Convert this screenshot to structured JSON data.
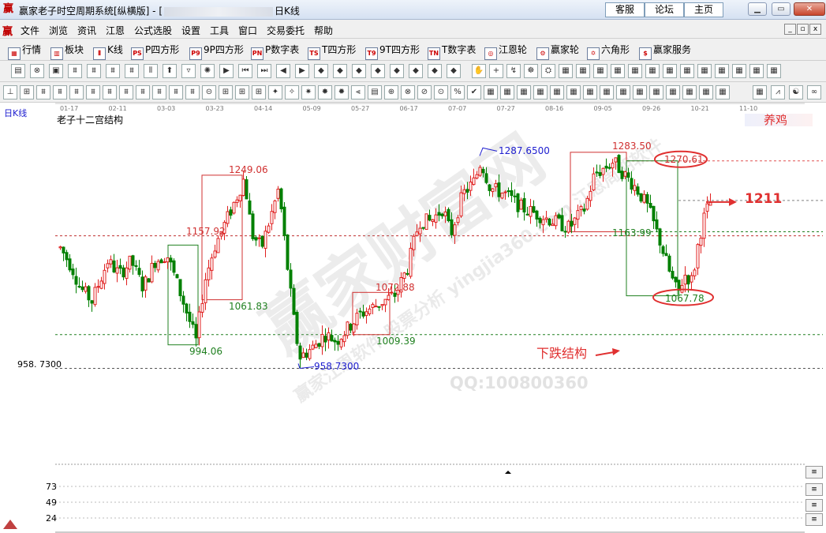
{
  "window": {
    "app_icon": "赢",
    "title_prefix": "赢家老子时空周期系统[纵横版] - [",
    "title_suffix": "日K线",
    "links": [
      "客服",
      "论坛",
      "主页"
    ],
    "controls": [
      "▁",
      "▭",
      "✕"
    ]
  },
  "menu": {
    "icon": "赢",
    "items": [
      "文件",
      "浏览",
      "资讯",
      "江恩",
      "公式选股",
      "设置",
      "工具",
      "窗口",
      "交易委托",
      "帮助"
    ],
    "mdi": [
      "_",
      "▫",
      "x"
    ]
  },
  "toolbar1": {
    "items": [
      {
        "label": "行情",
        "icon": "▦"
      },
      {
        "label": "板块",
        "icon": "▥"
      },
      {
        "label": "K线",
        "icon": "⫴"
      },
      {
        "label": "P四方形",
        "icon": "PS"
      },
      {
        "label": "9P四方形",
        "icon": "P9"
      },
      {
        "label": "P数字表",
        "icon": "PN"
      },
      {
        "label": "T四方形",
        "icon": "TS"
      },
      {
        "label": "9T四方形",
        "icon": "T9"
      },
      {
        "label": "T数字表",
        "icon": "TN"
      },
      {
        "label": "江恩轮",
        "icon": "◎"
      },
      {
        "label": "赢家轮",
        "icon": "⚙"
      },
      {
        "label": "六角形",
        "icon": "✡"
      },
      {
        "label": "赢家服务",
        "icon": "$"
      }
    ]
  },
  "chart": {
    "period_label": "日K线",
    "indicator_name": "老子十二宫结构",
    "tag_name": "养鸡",
    "date_ticks": [
      "01-17",
      "02-11",
      "03-03",
      "03-23",
      "04-14",
      "05-09",
      "05-27",
      "06-17",
      "07-07",
      "07-27",
      "08-16",
      "09-05",
      "09-26",
      "10-21",
      "11-10"
    ],
    "level_labels": {
      "high1": "1287.6500",
      "high2": "1283.50",
      "circle_top": "1270.61",
      "arrow_val": "1211",
      "l1249": "1249.06",
      "l1157": "1157.92",
      "l1163": "1163.99",
      "l1072": "1072.88",
      "l1067": "1067.78",
      "l1061": "1061.83",
      "l1009": "1009.39",
      "l994": "994.06",
      "low": "958.7300",
      "axis_low": "958. 7300"
    },
    "annotation_text": "下跌结构",
    "watermark_main": "赢家财富网",
    "watermark_sub": "赢家江恩软件 股票分析 yingjia360.com 江恩周期软件",
    "watermark_qq": "QQ:100800360",
    "volume_axis": [
      "73",
      "49",
      "24"
    ],
    "colors": {
      "up": "#e02020",
      "down": "#008000",
      "accent": "#e03030",
      "blue": "#2020d0"
    }
  }
}
